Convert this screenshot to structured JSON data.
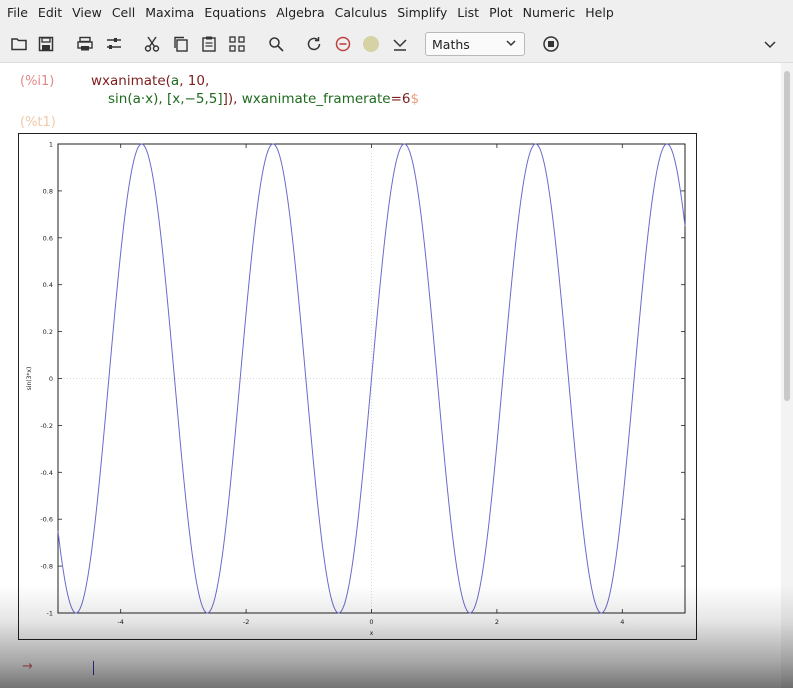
{
  "menu": [
    "File",
    "Edit",
    "View",
    "Cell",
    "Maxima",
    "Equations",
    "Algebra",
    "Calculus",
    "Simplify",
    "List",
    "Plot",
    "Numeric",
    "Help"
  ],
  "toolbar": {
    "icons": [
      "open-icon",
      "save-icon",
      "print-icon",
      "settings-icon",
      "cut-icon",
      "copy-icon",
      "paste-icon",
      "select-all-icon",
      "find-icon",
      "restart-icon",
      "interrupt-icon",
      "status-icon",
      "follow-icon",
      "stop-icon"
    ],
    "mode_select": "Maths",
    "status_color": "#d6d2a6"
  },
  "cell": {
    "input_label": "(%i1)",
    "output_label": "(%t1)",
    "line1": {
      "fn": "wxanimate(",
      "a": "a",
      "sep1": ", ",
      "n": "10",
      "end": ","
    },
    "line2": {
      "expr": "sin(a·x), [x,−5,5]",
      "close": "]), ",
      "opt": "wxanimate_framerate",
      "eq": "=",
      "val": "6",
      "term": "$"
    }
  },
  "chart_data": {
    "type": "line",
    "x_min": -5,
    "x_max": 5,
    "ylim": [
      -1,
      1
    ],
    "xticks": [
      -4,
      -2,
      0,
      2,
      4
    ],
    "yticks": [
      1,
      0.8,
      0.6,
      0.4,
      0.2,
      0,
      -0.2,
      -0.4,
      -0.6,
      -0.8,
      -1
    ],
    "xlabel": "x",
    "ylabel": "sin(3*x)",
    "frequency": 3,
    "line_color": "#6a6ad0",
    "grid": true
  },
  "input_marker": "→"
}
